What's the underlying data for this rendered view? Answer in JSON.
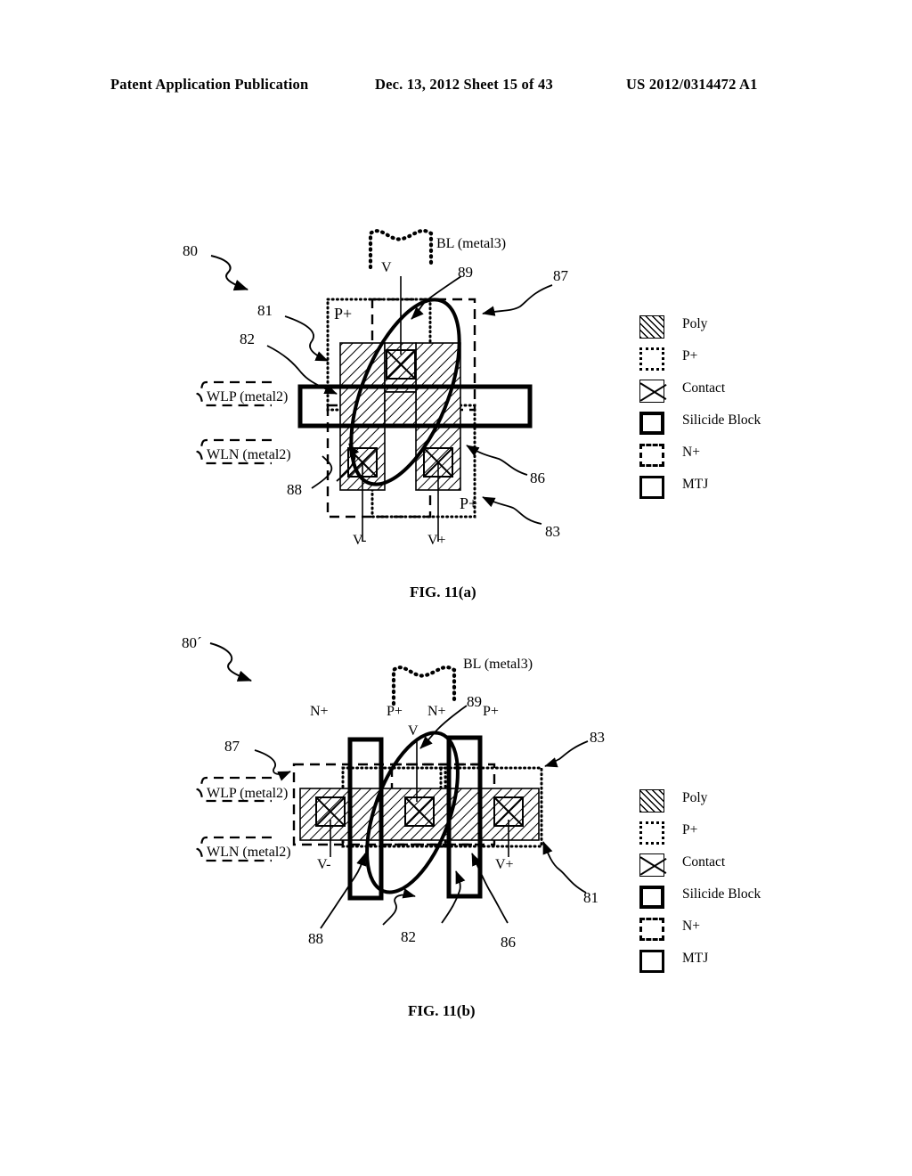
{
  "header": {
    "publication": "Patent Application Publication",
    "date_sheet": "Dec. 13, 2012  Sheet 15 of 43",
    "patent_number": "US 2012/0314472 A1"
  },
  "legend": {
    "items": [
      {
        "key": "poly",
        "label": "Poly"
      },
      {
        "key": "pplus",
        "label": "P+"
      },
      {
        "key": "contact",
        "label": "Contact"
      },
      {
        "key": "silicide",
        "label": "Silicide Block"
      },
      {
        "key": "nplus",
        "label": "N+"
      },
      {
        "key": "mtj",
        "label": "MTJ"
      }
    ]
  },
  "figure_a": {
    "caption": "FIG. 11(a)",
    "ref_numbers": [
      "80",
      "81",
      "82",
      "83",
      "86",
      "87",
      "88",
      "89"
    ],
    "labels": {
      "bl": "BL (metal3)",
      "wlp": "WLP (metal2)",
      "wln": "WLN (metal2)",
      "v": "V",
      "vminus": "V-",
      "vplus": "V+",
      "pplus_top": "P+",
      "pplus_bottom": "P+"
    }
  },
  "figure_b": {
    "caption": "FIG. 11(b)",
    "ref_numbers": [
      "80´",
      "81",
      "82",
      "83",
      "86",
      "87",
      "88",
      "89"
    ],
    "labels": {
      "bl": "BL (metal3)",
      "wlp": "WLP (metal2)",
      "wln": "WLN (metal2)",
      "v": "V",
      "vminus": "V-",
      "vplus": "V+",
      "diffusion_row": [
        "N+",
        "P+",
        "N+",
        "P+"
      ]
    }
  },
  "colors": {
    "ink": "#000000",
    "paper": "#ffffff"
  }
}
